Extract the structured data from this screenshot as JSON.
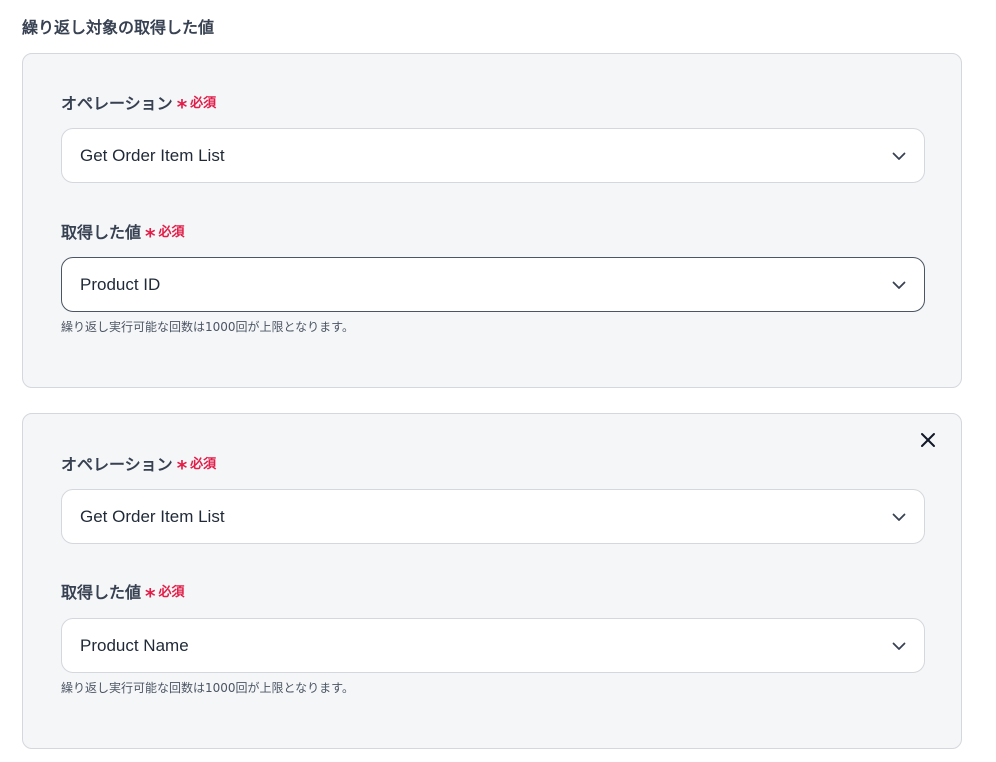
{
  "section_title": "繰り返し対象の取得した値",
  "required_mark": "*",
  "required_text": "必須",
  "cards": [
    {
      "operation_label": "オペレーション",
      "operation_value": "Get Order Item List",
      "value_label": "取得した値",
      "value_value": "Product ID",
      "hint": "繰り返し実行可能な回数は1000回が上限となります。"
    },
    {
      "operation_label": "オペレーション",
      "operation_value": "Get Order Item List",
      "value_label": "取得した値",
      "value_value": "Product Name",
      "hint": "繰り返し実行可能な回数は1000回が上限となります。"
    }
  ],
  "icons": {
    "dropdown": "chevron-down-icon",
    "remove": "close-icon"
  },
  "colors": {
    "required": "#e11d48",
    "card_bg": "#f5f6f8",
    "border": "#d4d7dd"
  }
}
